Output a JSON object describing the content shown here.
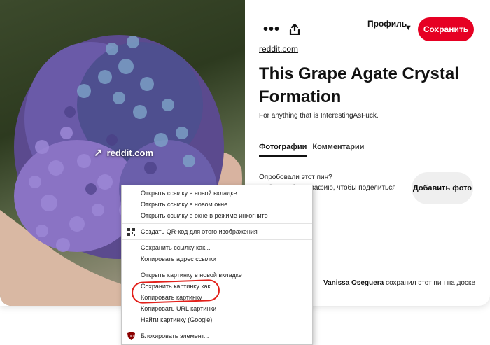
{
  "image": {
    "overlay_link": "reddit.com",
    "arrow_icon": "arrow-up-right-icon"
  },
  "header": {
    "more_icon": "•••",
    "share_icon": "share-icon",
    "profile_label": "Профиль",
    "save_label": "Сохранить",
    "save_color": "#e60023"
  },
  "pin": {
    "source": "reddit.com",
    "title": "This Grape Agate Crystal Formation",
    "description": "For anything that is InterestingAsFuck."
  },
  "tabs": [
    {
      "label": "Фотографии",
      "active": true
    },
    {
      "label": "Комментарии",
      "active": false
    }
  ],
  "tried": {
    "title": "Опробовали этот пин?",
    "subtitle": "Добавьте фотографию, чтобы поделиться",
    "add_photo_label": "Добавить фото"
  },
  "saved_by": {
    "user": "Vanissa Oseguera",
    "text": "сохранил этот пин на доске"
  },
  "context_menu": {
    "groups": [
      [
        "Открыть ссылку в новой вкладке",
        "Открыть ссылку в новом окне",
        "Открыть ссылку в окне в режиме инкогнито"
      ],
      [
        "Создать QR-код для этого изображения"
      ],
      [
        "Сохранить ссылку как...",
        "Копировать адрес ссылки"
      ],
      [
        "Открыть картинку в новой вкладке",
        "Сохранить картинку как...",
        "Копировать картинку",
        "Копировать URL картинки",
        "Найти картинку (Google)"
      ],
      [
        "Блокировать элемент..."
      ]
    ],
    "qr_icon": "qr-code-icon",
    "block_icon": "ublock-shield-icon"
  },
  "annotation": {
    "highlight_color": "#e2201a"
  }
}
